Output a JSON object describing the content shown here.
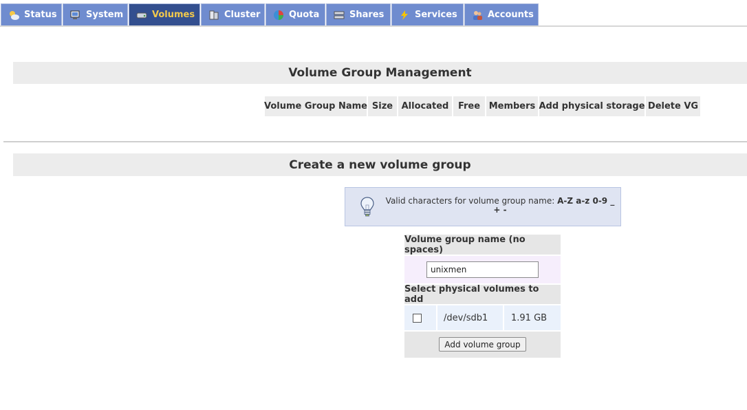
{
  "tabs": [
    {
      "label": "Status",
      "icon": "weather-icon"
    },
    {
      "label": "System",
      "icon": "monitor-icon"
    },
    {
      "label": "Volumes",
      "icon": "drive-icon",
      "active": true
    },
    {
      "label": "Cluster",
      "icon": "servers-icon"
    },
    {
      "label": "Quota",
      "icon": "pie-icon"
    },
    {
      "label": "Shares",
      "icon": "share-icon"
    },
    {
      "label": "Services",
      "icon": "lightning-icon"
    },
    {
      "label": "Accounts",
      "icon": "users-icon"
    }
  ],
  "vg_management": {
    "title": "Volume Group Management",
    "columns": [
      "Volume Group Name",
      "Size",
      "Allocated",
      "Free",
      "Members",
      "Add physical storage",
      "Delete VG"
    ]
  },
  "create": {
    "title": "Create a new volume group",
    "tip_prefix": "Valid characters for volume group name: ",
    "tip_chars_1": "A-Z a-z 0-9 _",
    "tip_chars_2": "+ -",
    "name_label": "Volume group name (no spaces)",
    "name_value": "unixmen",
    "pv_label": "Select physical volumes to add",
    "pv_rows": [
      {
        "device": "/dev/sdb1",
        "size": "1.91 GB",
        "checked": false
      }
    ],
    "add_button": "Add volume group"
  },
  "colors": {
    "tab_bg": "#6f8ccf",
    "tab_active_bg": "#334f8f",
    "tab_active_text": "#f2c94c",
    "header_bg": "#ececec",
    "info_bg": "#dfe4f2",
    "name_row_bg": "#f6eefc",
    "pv_row_bg": "#eaf1fb"
  }
}
